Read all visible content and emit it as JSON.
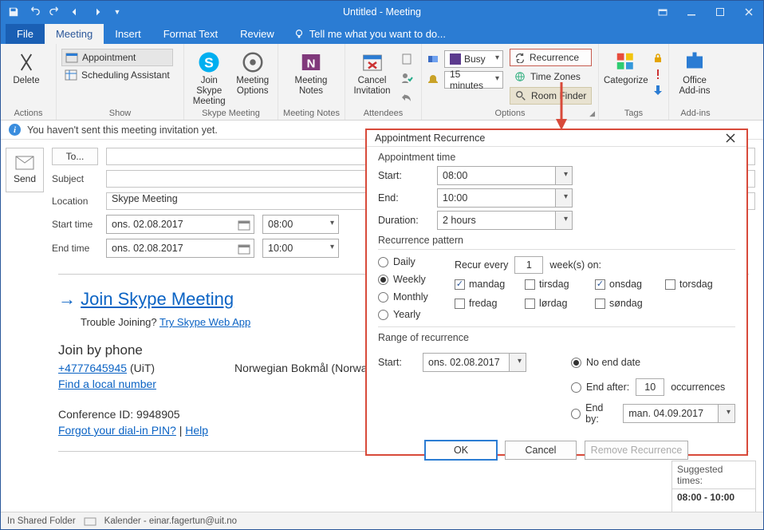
{
  "window": {
    "title": "Untitled - Meeting"
  },
  "tabs": {
    "file": "File",
    "meeting": "Meeting",
    "insert": "Insert",
    "format": "Format Text",
    "review": "Review",
    "tellme": "Tell me what you want to do..."
  },
  "ribbon": {
    "actions": {
      "label": "Actions",
      "delete": "Delete"
    },
    "show": {
      "label": "Show",
      "appointment": "Appointment",
      "scheduling": "Scheduling Assistant"
    },
    "skype": {
      "label": "Skype Meeting",
      "join": "Join Skype\nMeeting",
      "options": "Meeting\nOptions"
    },
    "notes": {
      "label": "Meeting Notes",
      "btn": "Meeting\nNotes"
    },
    "attendees": {
      "label": "Attendees",
      "cancel": "Cancel\nInvitation"
    },
    "options": {
      "label": "Options",
      "busy": "Busy",
      "reminder": "15 minutes",
      "recurrence": "Recurrence",
      "timezones": "Time Zones",
      "roomfinder": "Room Finder"
    },
    "tags": {
      "label": "Tags",
      "categorize": "Categorize"
    },
    "addins": {
      "label": "Add-ins",
      "office": "Office\nAdd-ins"
    }
  },
  "infobar": "You haven't sent this meeting invitation yet.",
  "compose": {
    "send": "Send",
    "to": "To...",
    "subject_label": "Subject",
    "subject": "",
    "location_label": "Location",
    "location": "Skype Meeting",
    "start_label": "Start time",
    "end_label": "End time",
    "start_date": "ons. 02.08.2017",
    "start_time": "08:00",
    "end_date": "ons. 02.08.2017",
    "end_time": "10:00"
  },
  "body": {
    "join_link": "Join Skype Meeting",
    "trouble": "Trouble Joining?",
    "webapp": "Try Skype Web App",
    "phone_h": "Join by phone",
    "phone_num": "+4777645945",
    "phone_org": "(UiT)",
    "lang": "Norwegian Bokmål (Norway)",
    "local": "Find a local number",
    "conf": "Conference ID: 9948905",
    "forgot": "Forgot your dial-in PIN?",
    "help": "Help"
  },
  "side": {
    "suggested": "Suggested times:",
    "slot": "08:00 - 10:00"
  },
  "status": {
    "folder_label": "In Shared Folder",
    "folder": "Kalender - einar.fagertun@uit.no"
  },
  "dlg": {
    "title": "Appointment Recurrence",
    "appt_h": "Appointment time",
    "start_l": "Start:",
    "start": "08:00",
    "end_l": "End:",
    "end": "10:00",
    "dur_l": "Duration:",
    "dur": "2 hours",
    "pat_h": "Recurrence pattern",
    "daily": "Daily",
    "weekly": "Weekly",
    "monthly": "Monthly",
    "yearly": "Yearly",
    "recur_every_pre": "Recur every",
    "recur_n": "1",
    "recur_every_post": "week(s) on:",
    "days": {
      "mon": "mandag",
      "tue": "tirsdag",
      "wed": "onsdag",
      "thu": "torsdag",
      "fri": "fredag",
      "sat": "lørdag",
      "sun": "søndag"
    },
    "range_h": "Range of recurrence",
    "range_start_l": "Start:",
    "range_start": "ons. 02.08.2017",
    "noend": "No end date",
    "endafter": "End after:",
    "occ_n": "10",
    "occ": "occurrences",
    "endby": "End by:",
    "endby_date": "man. 04.09.2017",
    "ok": "OK",
    "cancel": "Cancel",
    "remove": "Remove Recurrence"
  }
}
